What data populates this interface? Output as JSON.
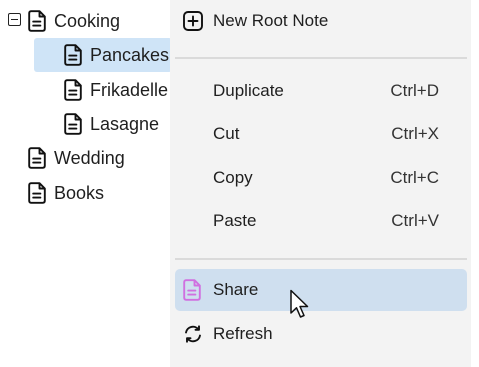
{
  "tree": {
    "items": [
      {
        "label": "Cooking",
        "expanded": true,
        "selected": false
      },
      {
        "label": "Pancakes",
        "selected": true
      },
      {
        "label": "Frikadelle",
        "selected": false
      },
      {
        "label": "Lasagne",
        "selected": false
      },
      {
        "label": "Wedding",
        "selected": false
      },
      {
        "label": "Books",
        "selected": false
      }
    ]
  },
  "menu": {
    "new_root_note": {
      "label": "New Root Note",
      "icon": "plus-square-icon"
    },
    "duplicate": {
      "label": "Duplicate",
      "shortcut": "Ctrl+D"
    },
    "cut": {
      "label": "Cut",
      "shortcut": "Ctrl+X"
    },
    "copy": {
      "label": "Copy",
      "shortcut": "Ctrl+C"
    },
    "paste": {
      "label": "Paste",
      "shortcut": "Ctrl+V"
    },
    "share": {
      "label": "Share",
      "icon": "note-icon",
      "icon_color": "#d070e0",
      "hovered": true
    },
    "refresh": {
      "label": "Refresh",
      "icon": "refresh-icon"
    }
  },
  "colors": {
    "selection": "#cfe4f7",
    "menu_background": "#f3f3f3",
    "menu_hover": "#cfdfef"
  }
}
